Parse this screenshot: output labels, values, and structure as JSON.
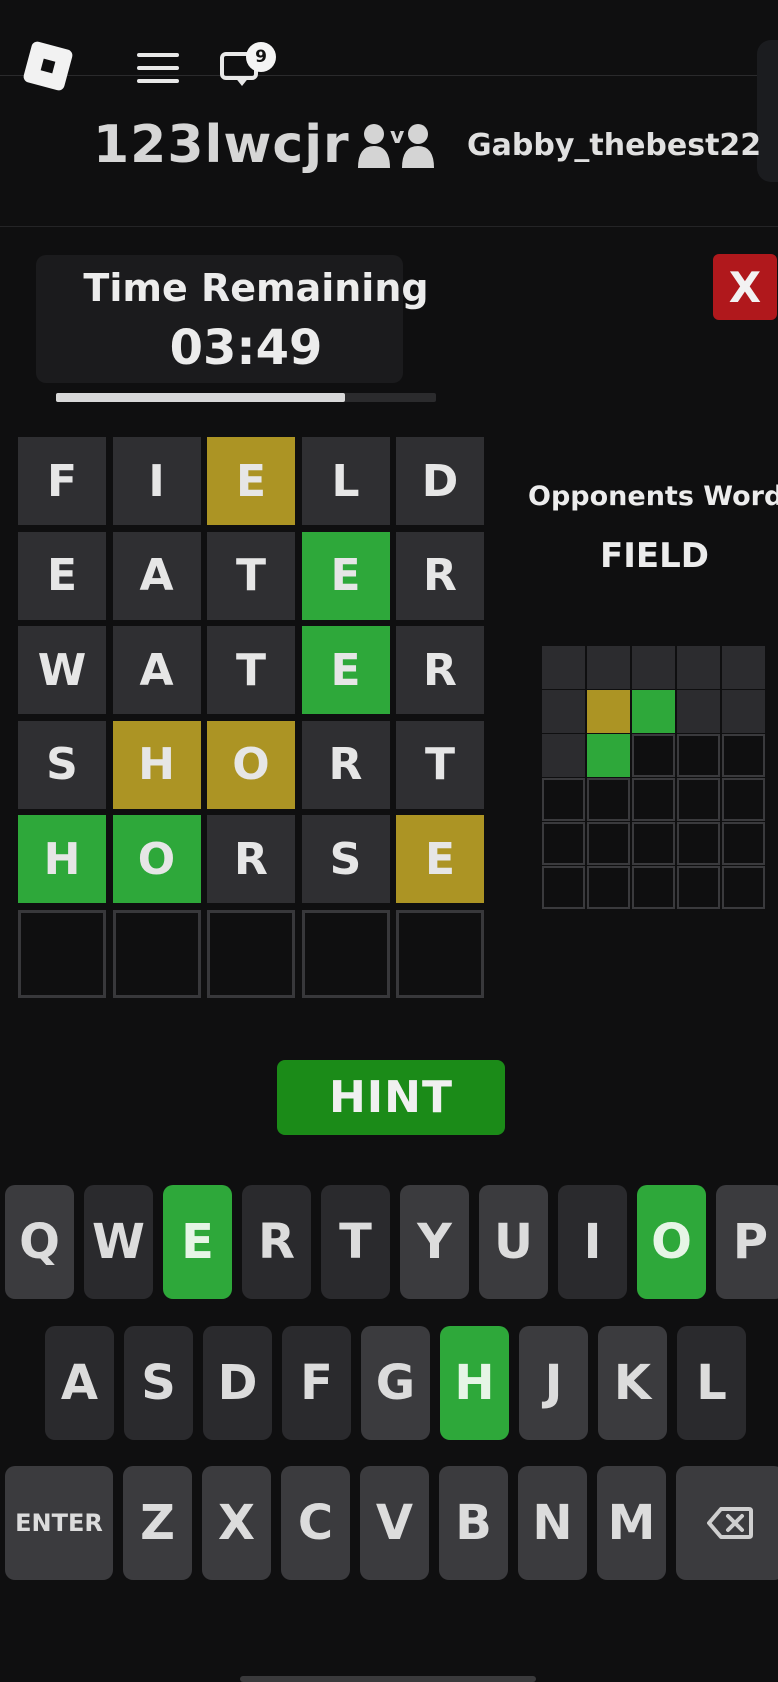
{
  "header": {
    "notification_count": "9",
    "player_name": "123lwcjr",
    "vs_letter": "v",
    "opponent_name": "Gabby_thebest22"
  },
  "timer": {
    "label": "Time Remaining",
    "value": "03:49",
    "progress_fraction": 0.76
  },
  "close_label": "X",
  "board": [
    [
      {
        "l": "F",
        "s": "absent"
      },
      {
        "l": "I",
        "s": "absent"
      },
      {
        "l": "E",
        "s": "present"
      },
      {
        "l": "L",
        "s": "absent"
      },
      {
        "l": "D",
        "s": "absent"
      }
    ],
    [
      {
        "l": "E",
        "s": "absent"
      },
      {
        "l": "A",
        "s": "absent"
      },
      {
        "l": "T",
        "s": "absent"
      },
      {
        "l": "E",
        "s": "correct"
      },
      {
        "l": "R",
        "s": "absent"
      }
    ],
    [
      {
        "l": "W",
        "s": "absent"
      },
      {
        "l": "A",
        "s": "absent"
      },
      {
        "l": "T",
        "s": "absent"
      },
      {
        "l": "E",
        "s": "correct"
      },
      {
        "l": "R",
        "s": "absent"
      }
    ],
    [
      {
        "l": "S",
        "s": "absent"
      },
      {
        "l": "H",
        "s": "present"
      },
      {
        "l": "O",
        "s": "present"
      },
      {
        "l": "R",
        "s": "absent"
      },
      {
        "l": "T",
        "s": "absent"
      }
    ],
    [
      {
        "l": "H",
        "s": "correct"
      },
      {
        "l": "O",
        "s": "correct"
      },
      {
        "l": "R",
        "s": "absent"
      },
      {
        "l": "S",
        "s": "absent"
      },
      {
        "l": "E",
        "s": "present"
      }
    ],
    [
      {
        "l": "",
        "s": "empty"
      },
      {
        "l": "",
        "s": "empty"
      },
      {
        "l": "",
        "s": "empty"
      },
      {
        "l": "",
        "s": "empty"
      },
      {
        "l": "",
        "s": "empty"
      }
    ]
  ],
  "opponent": {
    "label": "Opponents Word:",
    "word": "FIELD",
    "grid": [
      [
        "absent",
        "absent",
        "absent",
        "absent",
        "absent"
      ],
      [
        "absent",
        "present",
        "correct",
        "absent",
        "absent"
      ],
      [
        "absent",
        "correct",
        "empty",
        "empty",
        "empty"
      ],
      [
        "empty",
        "empty",
        "empty",
        "empty",
        "empty"
      ],
      [
        "empty",
        "empty",
        "empty",
        "empty",
        "empty"
      ],
      [
        "empty",
        "empty",
        "empty",
        "empty",
        "empty"
      ]
    ]
  },
  "hint_label": "HINT",
  "keyboard": {
    "rows": [
      [
        {
          "k": "Q",
          "s": "absent"
        },
        {
          "k": "W",
          "s": "dark"
        },
        {
          "k": "E",
          "s": "correct"
        },
        {
          "k": "R",
          "s": "dark"
        },
        {
          "k": "T",
          "s": "dark"
        },
        {
          "k": "Y",
          "s": "absent"
        },
        {
          "k": "U",
          "s": "absent"
        },
        {
          "k": "I",
          "s": "dark"
        },
        {
          "k": "O",
          "s": "correct"
        },
        {
          "k": "P",
          "s": "absent"
        }
      ],
      [
        {
          "k": "A",
          "s": "dark"
        },
        {
          "k": "S",
          "s": "dark"
        },
        {
          "k": "D",
          "s": "dark"
        },
        {
          "k": "F",
          "s": "dark"
        },
        {
          "k": "G",
          "s": "absent"
        },
        {
          "k": "H",
          "s": "correct"
        },
        {
          "k": "J",
          "s": "absent"
        },
        {
          "k": "K",
          "s": "absent"
        },
        {
          "k": "L",
          "s": "dark"
        }
      ],
      [
        {
          "k": "ENTER",
          "s": "absent"
        },
        {
          "k": "Z",
          "s": "absent"
        },
        {
          "k": "X",
          "s": "absent"
        },
        {
          "k": "C",
          "s": "absent"
        },
        {
          "k": "V",
          "s": "absent"
        },
        {
          "k": "B",
          "s": "absent"
        },
        {
          "k": "N",
          "s": "absent"
        },
        {
          "k": "M",
          "s": "absent"
        },
        {
          "k": "backspace-icon",
          "s": "absent"
        }
      ]
    ]
  },
  "colors": {
    "correct": "#2ea83a",
    "present": "#ac9424",
    "absent": "#2f2f32",
    "close": "#b0181c",
    "hint": "#1b8b18"
  }
}
